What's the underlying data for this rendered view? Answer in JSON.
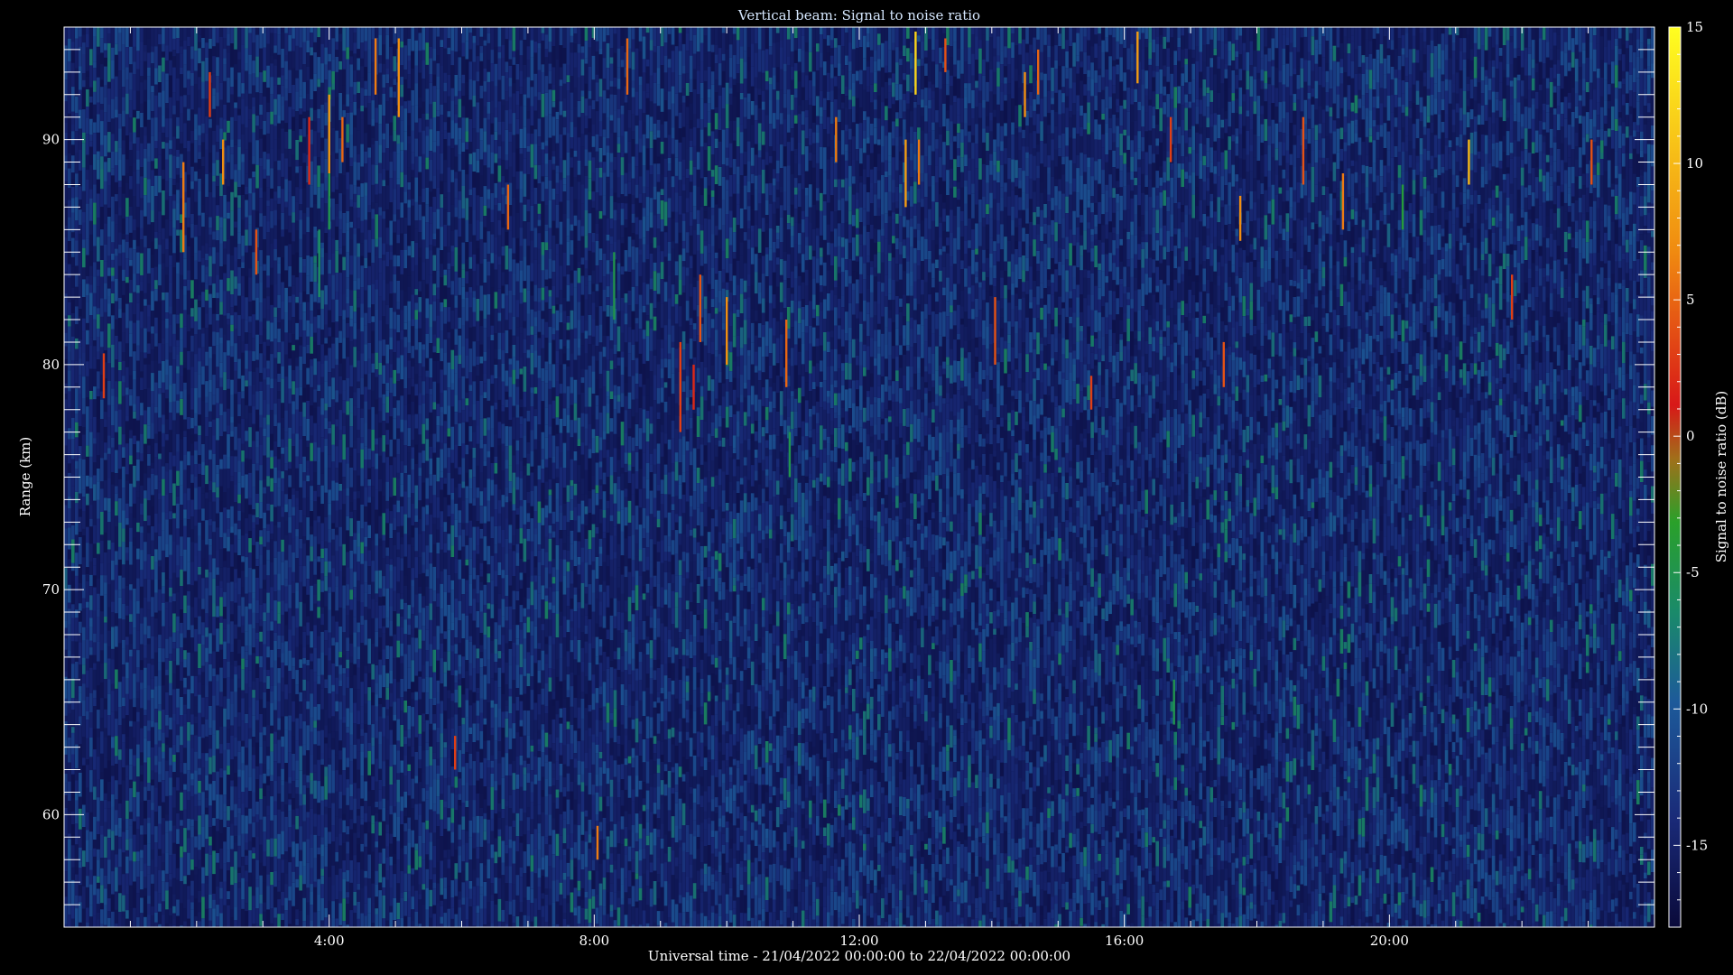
{
  "chart_data": {
    "type": "heatmap",
    "title": "Vertical beam: Signal to noise ratio",
    "xlabel": "Universal time - 21/04/2022 00:00:00 to 22/04/2022 00:00:00",
    "ylabel": "Range (km)",
    "xlim_hours": [
      0,
      24
    ],
    "ylim_km": [
      55,
      95
    ],
    "x_ticks": [
      {
        "value": 4,
        "label": "4:00"
      },
      {
        "value": 8,
        "label": "8:00"
      },
      {
        "value": 12,
        "label": "12:00"
      },
      {
        "value": 16,
        "label": "16:00"
      },
      {
        "value": 20,
        "label": "20:00"
      }
    ],
    "y_ticks": [
      {
        "value": 60,
        "label": "60"
      },
      {
        "value": 70,
        "label": "70"
      },
      {
        "value": 80,
        "label": "80"
      },
      {
        "value": 90,
        "label": "90"
      }
    ],
    "colorbar": {
      "label": "Signal to noise ratio (dB)",
      "range_db": [
        -18,
        15
      ],
      "ticks": [
        "15",
        "10",
        "5",
        "0",
        "-5",
        "-10",
        "-15"
      ],
      "tick_values": [
        15,
        10,
        5,
        0,
        -5,
        -10,
        -15
      ],
      "colors": [
        "#0a0a3a",
        "#1a2a78",
        "#1d5a9a",
        "#1a8a6a",
        "#2aa02a",
        "#a0701a",
        "#d81818",
        "#f08a10",
        "#ffff20"
      ]
    },
    "background_db": -14,
    "events": [
      {
        "t": 0.6,
        "r0": 78.5,
        "r1": 80.5,
        "db": 3
      },
      {
        "t": 1.8,
        "r0": 85,
        "r1": 89,
        "db": 6
      },
      {
        "t": 2.2,
        "r0": 91,
        "r1": 93,
        "db": 3
      },
      {
        "t": 2.4,
        "r0": 88,
        "r1": 90,
        "db": 7
      },
      {
        "t": 2.9,
        "r0": 84,
        "r1": 86,
        "db": 4
      },
      {
        "t": 3.7,
        "r0": 88,
        "r1": 91,
        "db": 2
      },
      {
        "t": 3.85,
        "r0": 83,
        "r1": 86,
        "db": -6
      },
      {
        "t": 4.0,
        "r0": 87.5,
        "r1": 92,
        "db": 8
      },
      {
        "t": 4.2,
        "r0": 89,
        "r1": 91,
        "db": 5
      },
      {
        "t": 4.7,
        "r0": 92,
        "r1": 94.5,
        "db": 6
      },
      {
        "t": 5.05,
        "r0": 91,
        "r1": 94.5,
        "db": 7
      },
      {
        "t": 5.9,
        "r0": 62,
        "r1": 63.5,
        "db": 3
      },
      {
        "t": 6.7,
        "r0": 86,
        "r1": 88,
        "db": 5
      },
      {
        "t": 8.05,
        "r0": 58,
        "r1": 59.5,
        "db": 6
      },
      {
        "t": 8.3,
        "r0": 82,
        "r1": 85,
        "db": -5
      },
      {
        "t": 8.5,
        "r0": 92,
        "r1": 94.5,
        "db": 5
      },
      {
        "t": 9.3,
        "r0": 77,
        "r1": 81,
        "db": 3
      },
      {
        "t": 9.5,
        "r0": 78,
        "r1": 80,
        "db": 2
      },
      {
        "t": 9.6,
        "r0": 81,
        "r1": 84,
        "db": 4
      },
      {
        "t": 10.0,
        "r0": 80,
        "r1": 83,
        "db": 7
      },
      {
        "t": 10.9,
        "r0": 79,
        "r1": 82,
        "db": 5
      },
      {
        "t": 11.65,
        "r0": 89,
        "r1": 91,
        "db": 6
      },
      {
        "t": 12.7,
        "r0": 87,
        "r1": 90,
        "db": 8
      },
      {
        "t": 12.85,
        "r0": 92,
        "r1": 94.8,
        "db": 12
      },
      {
        "t": 12.9,
        "r0": 88,
        "r1": 90,
        "db": 6
      },
      {
        "t": 13.3,
        "r0": 93,
        "r1": 94.5,
        "db": 4
      },
      {
        "t": 14.05,
        "r0": 80,
        "r1": 83,
        "db": 4
      },
      {
        "t": 14.5,
        "r0": 91,
        "r1": 93,
        "db": 7
      },
      {
        "t": 14.7,
        "r0": 92,
        "r1": 94,
        "db": 5
      },
      {
        "t": 15.5,
        "r0": 78,
        "r1": 79.5,
        "db": 3
      },
      {
        "t": 16.2,
        "r0": 92.5,
        "r1": 94.8,
        "db": 8
      },
      {
        "t": 16.7,
        "r0": 89,
        "r1": 91,
        "db": 3
      },
      {
        "t": 17.5,
        "r0": 79,
        "r1": 81,
        "db": 4
      },
      {
        "t": 17.75,
        "r0": 85.5,
        "r1": 87.5,
        "db": 7
      },
      {
        "t": 18.7,
        "r0": 88,
        "r1": 91,
        "db": 4
      },
      {
        "t": 19.3,
        "r0": 86,
        "r1": 88.5,
        "db": 6
      },
      {
        "t": 20.2,
        "r0": 86,
        "r1": 88,
        "db": -4
      },
      {
        "t": 21.2,
        "r0": 88,
        "r1": 90,
        "db": 10
      },
      {
        "t": 21.85,
        "r0": 82,
        "r1": 84,
        "db": 3
      },
      {
        "t": 23.05,
        "r0": 88,
        "r1": 90,
        "db": 4
      },
      {
        "t": 10.95,
        "r0": 75,
        "r1": 77,
        "db": -5
      },
      {
        "t": 16.75,
        "r0": 64,
        "r1": 66,
        "db": -5
      },
      {
        "t": 4.0,
        "r0": 86,
        "r1": 88.5,
        "db": -5
      }
    ]
  }
}
